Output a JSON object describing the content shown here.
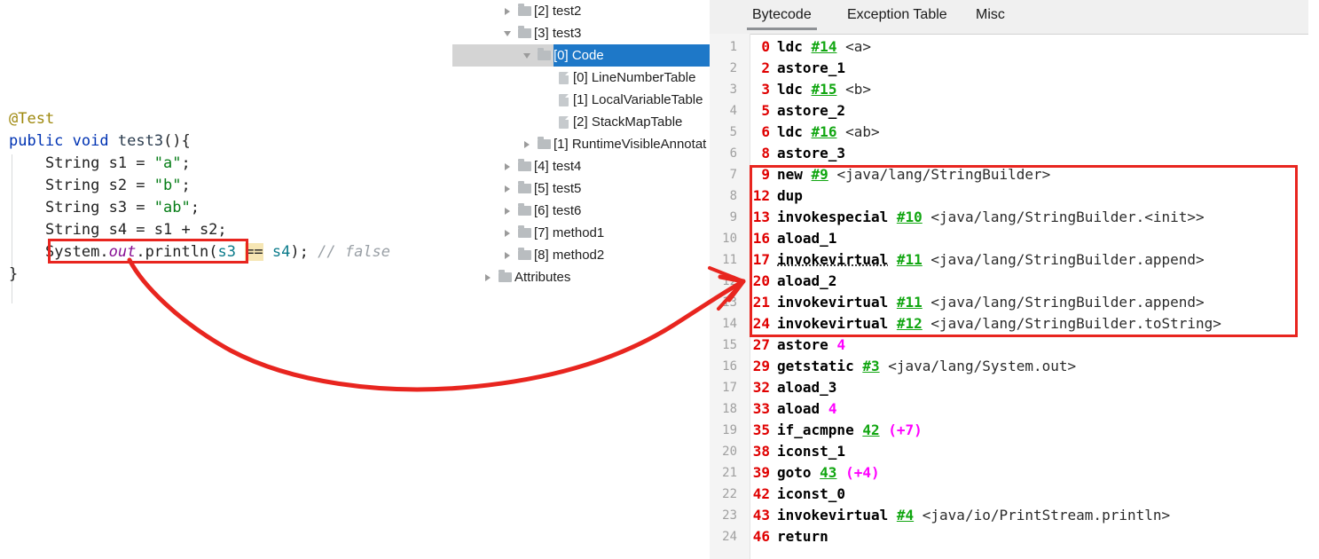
{
  "editor": {
    "lines": [
      {
        "id": "l1",
        "indent": 0,
        "tokens": [
          {
            "t": "@Test",
            "c": "t-ann"
          }
        ]
      },
      {
        "id": "l2",
        "indent": 0,
        "tokens": [
          {
            "t": "public",
            "c": "t-kw"
          },
          {
            "t": " ",
            "c": "t-plain"
          },
          {
            "t": "void",
            "c": "t-kw"
          },
          {
            "t": " ",
            "c": "t-plain"
          },
          {
            "t": "test3",
            "c": "t-meth"
          },
          {
            "t": "(){",
            "c": "t-plain"
          }
        ]
      },
      {
        "id": "l3",
        "indent": 1,
        "tokens": [
          {
            "t": "String s1 = ",
            "c": "t-plain"
          },
          {
            "t": "\"a\"",
            "c": "t-str"
          },
          {
            "t": ";",
            "c": "t-plain"
          }
        ]
      },
      {
        "id": "l4",
        "indent": 1,
        "tokens": [
          {
            "t": "String s2 = ",
            "c": "t-plain"
          },
          {
            "t": "\"b\"",
            "c": "t-str"
          },
          {
            "t": ";",
            "c": "t-plain"
          }
        ]
      },
      {
        "id": "l5",
        "indent": 1,
        "tokens": [
          {
            "t": "String s3 = ",
            "c": "t-plain"
          },
          {
            "t": "\"ab\"",
            "c": "t-str"
          },
          {
            "t": ";",
            "c": "t-plain"
          }
        ]
      },
      {
        "id": "l6",
        "indent": 1,
        "tokens": [
          {
            "t": "String s4 = s1 + s2;",
            "c": "t-plain"
          }
        ]
      },
      {
        "id": "l7",
        "indent": 1,
        "tokens": [
          {
            "t": "System.",
            "c": "t-plain"
          },
          {
            "t": "out",
            "c": "t-field"
          },
          {
            "t": ".println(",
            "c": "t-plain"
          },
          {
            "t": "s3",
            "c": "t-local"
          },
          {
            "t": " ",
            "c": "t-plain"
          },
          {
            "t": "==",
            "c": "t-plain t-hl"
          },
          {
            "t": " ",
            "c": "t-plain"
          },
          {
            "t": "s4",
            "c": "t-local"
          },
          {
            "t": ");",
            "c": "t-plain"
          },
          {
            "t": " ",
            "c": "t-plain"
          },
          {
            "t": "// false",
            "c": "t-cmt"
          }
        ]
      },
      {
        "id": "l8",
        "indent": 0,
        "tokens": [
          {
            "t": "}",
            "c": "t-plain"
          }
        ]
      }
    ],
    "highlight_box_label": "String s4 = s1 + s2;"
  },
  "tree": {
    "items": [
      {
        "label": "[2] test2",
        "icon": "folder-icon",
        "twisty": "right",
        "indent": 2,
        "selected": false
      },
      {
        "label": "[3] test3",
        "icon": "folder-icon",
        "twisty": "down",
        "indent": 2,
        "selected": false
      },
      {
        "label": "[0] Code",
        "icon": "folder-icon",
        "twisty": "down",
        "indent": 3,
        "selected": true
      },
      {
        "label": "[0] LineNumberTable",
        "icon": "document-icon",
        "twisty": "none",
        "indent": 4,
        "selected": false
      },
      {
        "label": "[1] LocalVariableTable",
        "icon": "document-icon",
        "twisty": "none",
        "indent": 4,
        "selected": false
      },
      {
        "label": "[2] StackMapTable",
        "icon": "document-icon",
        "twisty": "none",
        "indent": 4,
        "selected": false
      },
      {
        "label": "[1] RuntimeVisibleAnnotat",
        "icon": "folder-icon",
        "twisty": "right",
        "indent": 3,
        "selected": false
      },
      {
        "label": "[4] test4",
        "icon": "folder-icon",
        "twisty": "right",
        "indent": 2,
        "selected": false
      },
      {
        "label": "[5] test5",
        "icon": "folder-icon",
        "twisty": "right",
        "indent": 2,
        "selected": false
      },
      {
        "label": "[6] test6",
        "icon": "folder-icon",
        "twisty": "right",
        "indent": 2,
        "selected": false
      },
      {
        "label": "[7] method1",
        "icon": "folder-icon",
        "twisty": "right",
        "indent": 2,
        "selected": false
      },
      {
        "label": "[8] method2",
        "icon": "folder-icon",
        "twisty": "right",
        "indent": 2,
        "selected": false
      },
      {
        "label": "Attributes",
        "icon": "folder-icon",
        "twisty": "right",
        "indent": 1,
        "selected": false
      }
    ]
  },
  "bytecode_panel": {
    "tabs": [
      {
        "id": "bytecode",
        "label": "Bytecode",
        "active": true
      },
      {
        "id": "exception_table",
        "label": "Exception Table",
        "active": false
      },
      {
        "id": "misc",
        "label": "Misc",
        "active": false
      }
    ],
    "rows": [
      {
        "line": "1",
        "offset": "0",
        "parts": [
          {
            "t": "ldc",
            "c": "m"
          },
          {
            "t": " ",
            "c": "sig"
          },
          {
            "t": "#14",
            "c": "cp"
          },
          {
            "t": " <a>",
            "c": "sig"
          }
        ]
      },
      {
        "line": "2",
        "offset": "2",
        "parts": [
          {
            "t": "astore_1",
            "c": "m"
          }
        ]
      },
      {
        "line": "3",
        "offset": "3",
        "parts": [
          {
            "t": "ldc",
            "c": "m"
          },
          {
            "t": " ",
            "c": "sig"
          },
          {
            "t": "#15",
            "c": "cp"
          },
          {
            "t": " <b>",
            "c": "sig"
          }
        ]
      },
      {
        "line": "4",
        "offset": "5",
        "parts": [
          {
            "t": "astore_2",
            "c": "m"
          }
        ]
      },
      {
        "line": "5",
        "offset": "6",
        "parts": [
          {
            "t": "ldc",
            "c": "m"
          },
          {
            "t": " ",
            "c": "sig"
          },
          {
            "t": "#16",
            "c": "cp"
          },
          {
            "t": " <ab>",
            "c": "sig"
          }
        ]
      },
      {
        "line": "6",
        "offset": "8",
        "parts": [
          {
            "t": "astore_3",
            "c": "m"
          }
        ]
      },
      {
        "line": "7",
        "offset": "9",
        "parts": [
          {
            "t": "new",
            "c": "m"
          },
          {
            "t": " ",
            "c": "sig"
          },
          {
            "t": "#9",
            "c": "cp"
          },
          {
            "t": " <java/lang/StringBuilder>",
            "c": "sig"
          }
        ]
      },
      {
        "line": "8",
        "offset": "12",
        "parts": [
          {
            "t": "dup",
            "c": "m"
          }
        ]
      },
      {
        "line": "9",
        "offset": "13",
        "parts": [
          {
            "t": "invokespecial",
            "c": "m"
          },
          {
            "t": " ",
            "c": "sig"
          },
          {
            "t": "#10",
            "c": "cp"
          },
          {
            "t": " <java/lang/StringBuilder.<init>>",
            "c": "sig"
          }
        ]
      },
      {
        "line": "10",
        "offset": "16",
        "parts": [
          {
            "t": "aload_1",
            "c": "m"
          }
        ]
      },
      {
        "line": "11",
        "offset": "17",
        "parts": [
          {
            "t": "invokevirtual",
            "c": "m-u"
          },
          {
            "t": " ",
            "c": "sig"
          },
          {
            "t": "#11",
            "c": "cp"
          },
          {
            "t": " <java/lang/StringBuilder.append>",
            "c": "sig"
          }
        ]
      },
      {
        "line": "12",
        "offset": "20",
        "parts": [
          {
            "t": "aload_2",
            "c": "m"
          }
        ]
      },
      {
        "line": "13",
        "offset": "21",
        "parts": [
          {
            "t": "invokevirtual",
            "c": "m"
          },
          {
            "t": " ",
            "c": "sig"
          },
          {
            "t": "#11",
            "c": "cp"
          },
          {
            "t": " <java/lang/StringBuilder.append>",
            "c": "sig"
          }
        ]
      },
      {
        "line": "14",
        "offset": "24",
        "parts": [
          {
            "t": "invokevirtual",
            "c": "m"
          },
          {
            "t": " ",
            "c": "sig"
          },
          {
            "t": "#12",
            "c": "cp"
          },
          {
            "t": " <java/lang/StringBuilder.toString>",
            "c": "sig"
          }
        ]
      },
      {
        "line": "15",
        "offset": "27",
        "parts": [
          {
            "t": "astore",
            "c": "m"
          },
          {
            "t": " ",
            "c": "sig"
          },
          {
            "t": "4",
            "c": "idx"
          }
        ]
      },
      {
        "line": "16",
        "offset": "29",
        "parts": [
          {
            "t": "getstatic",
            "c": "m"
          },
          {
            "t": " ",
            "c": "sig"
          },
          {
            "t": "#3",
            "c": "cp"
          },
          {
            "t": " <java/lang/System.out>",
            "c": "sig"
          }
        ]
      },
      {
        "line": "17",
        "offset": "32",
        "parts": [
          {
            "t": "aload_3",
            "c": "m"
          }
        ]
      },
      {
        "line": "18",
        "offset": "33",
        "parts": [
          {
            "t": "aload",
            "c": "m"
          },
          {
            "t": " ",
            "c": "sig"
          },
          {
            "t": "4",
            "c": "idx"
          }
        ]
      },
      {
        "line": "19",
        "offset": "35",
        "parts": [
          {
            "t": "if_acmpne",
            "c": "m"
          },
          {
            "t": " ",
            "c": "sig"
          },
          {
            "t": "42",
            "c": "tgt"
          },
          {
            "t": " ",
            "c": "sig"
          },
          {
            "t": "(+7)",
            "c": "off"
          }
        ]
      },
      {
        "line": "20",
        "offset": "38",
        "parts": [
          {
            "t": "iconst_1",
            "c": "m"
          }
        ]
      },
      {
        "line": "21",
        "offset": "39",
        "parts": [
          {
            "t": "goto",
            "c": "m"
          },
          {
            "t": " ",
            "c": "sig"
          },
          {
            "t": "43",
            "c": "tgt"
          },
          {
            "t": " ",
            "c": "sig"
          },
          {
            "t": "(+4)",
            "c": "off"
          }
        ]
      },
      {
        "line": "22",
        "offset": "42",
        "parts": [
          {
            "t": "iconst_0",
            "c": "m"
          }
        ]
      },
      {
        "line": "23",
        "offset": "43",
        "parts": [
          {
            "t": "invokevirtual",
            "c": "m"
          },
          {
            "t": " ",
            "c": "sig"
          },
          {
            "t": "#4",
            "c": "cp"
          },
          {
            "t": " <java/io/PrintStream.println>",
            "c": "sig"
          }
        ]
      },
      {
        "line": "24",
        "offset": "46",
        "parts": [
          {
            "t": "return",
            "c": "m"
          }
        ]
      }
    ]
  },
  "annotations": {
    "accent_red": "#e8251f",
    "selection_blue": "#1e78c8",
    "arrow_name": "red-annotation-arrow"
  }
}
